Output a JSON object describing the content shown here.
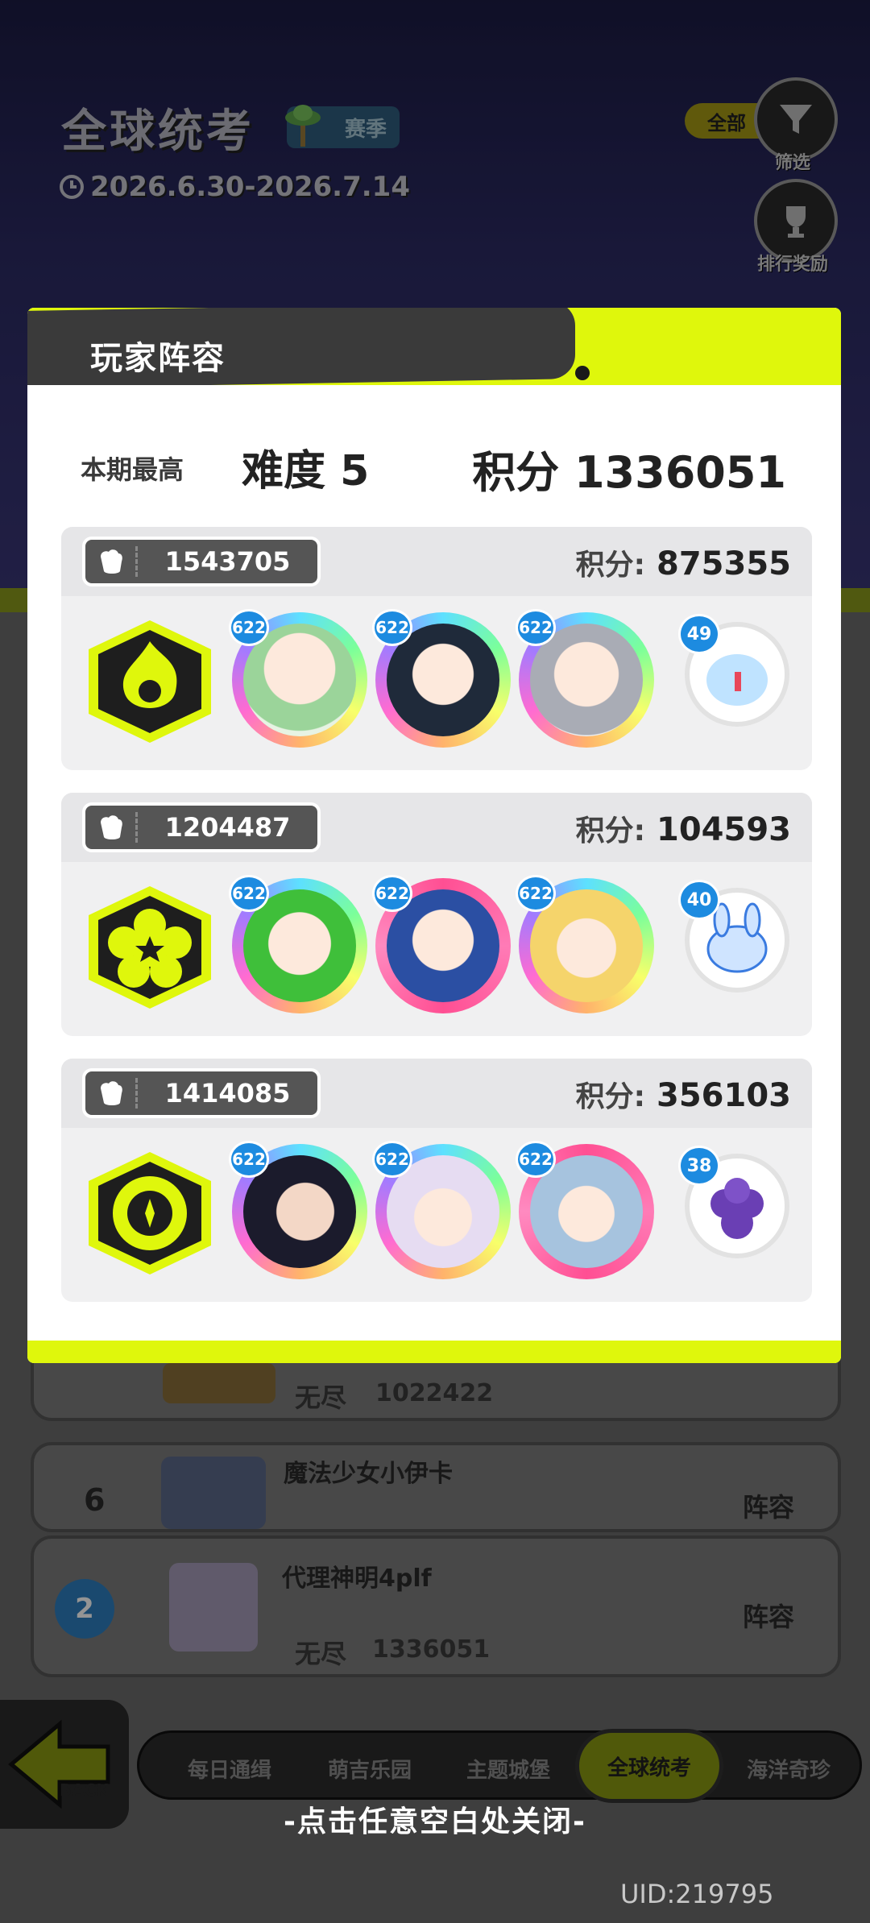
{
  "header": {
    "title": "全球统考",
    "season_badge": "赛季",
    "date_range": "2026.6.30-2026.7.14",
    "filter_all": "全部",
    "filter_label": "筛选",
    "rewards_label": "排行奖励"
  },
  "modal": {
    "title": "玩家阵容",
    "best_label": "本期最高",
    "best_difficulty": "难度 5",
    "best_score": "积分 1336051",
    "score_label": "积分:",
    "teams": [
      {
        "power": "1543705",
        "score": "875355",
        "levels": [
          "622",
          "622",
          "622"
        ],
        "pet_level": "49"
      },
      {
        "power": "1204487",
        "score": "104593",
        "levels": [
          "622",
          "622",
          "622"
        ],
        "pet_level": "40"
      },
      {
        "power": "1414085",
        "score": "356103",
        "levels": [
          "622",
          "622",
          "622"
        ],
        "pet_level": "38"
      }
    ]
  },
  "background_list": {
    "row_prev": {
      "mode": "无尽",
      "score": "1022422"
    },
    "row_6": {
      "rank": "6",
      "name": "魔法少女小伊卡",
      "lineup": "阵容"
    },
    "row_self": {
      "rank": "2",
      "name": "代理神明4plf",
      "mode": "无尽",
      "score": "1336051",
      "lineup": "阵容"
    }
  },
  "nav": {
    "items": [
      "每日通缉",
      "萌吉乐园",
      "主题城堡",
      "全球统考",
      "海洋奇珍"
    ],
    "active": "全球统考",
    "back": "BACK"
  },
  "close_hint": "-点击任意空白处关闭-",
  "uid": "UID:219795",
  "colors": {
    "accent_lime": "#dff70c",
    "dark": "#3a3a3a",
    "level_blue": "#1d8be0"
  }
}
